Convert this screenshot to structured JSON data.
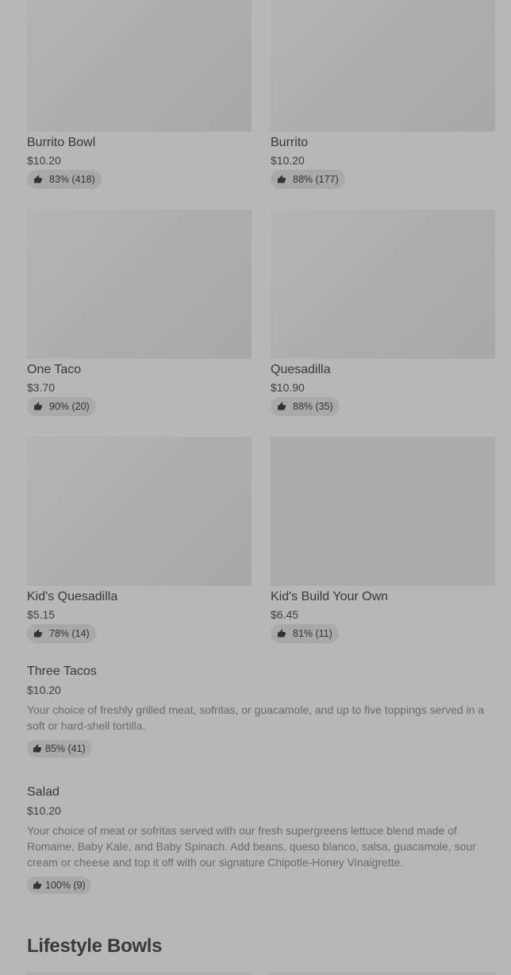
{
  "cards": [
    {
      "name": "Burrito Bowl",
      "price": "$10.20",
      "rating": "83% (418)"
    },
    {
      "name": "Burrito",
      "price": "$10.20",
      "rating": "88% (177)"
    },
    {
      "name": "One Taco",
      "price": "$3.70",
      "rating": "90% (20)"
    },
    {
      "name": "Quesadilla",
      "price": "$10.90",
      "rating": "88% (35)"
    },
    {
      "name": "Kid's Quesadilla",
      "price": "$5.15",
      "rating": "78% (14)"
    },
    {
      "name": "Kid's Build Your Own",
      "price": "$6.45",
      "rating": "81% (11)"
    }
  ],
  "list_items": [
    {
      "name": "Three Tacos",
      "price": "$10.20",
      "description": "Your choice of freshly grilled meat, sofritas, or guacamole, and up to five toppings served in a soft or hard-shell tortilla.",
      "rating": "85% (41)"
    },
    {
      "name": "Salad",
      "price": "$10.20",
      "description": "Your choice of meat or sofritas served with our fresh supergreens lettuce blend made of Romaine, Baby Kale, and Baby Spinach. Add beans, queso blanco, salsa, guacamole, sour cream or cheese and top it off with our signature Chipotle-Honey Vinaigrette.",
      "rating": "100% (9)"
    }
  ],
  "section": {
    "title": "Lifestyle Bowls"
  },
  "icons": {
    "rating": "thumbs-up-icon"
  },
  "colors": {
    "overlay": "#b7b7b7",
    "text": "#3a3a3a"
  }
}
